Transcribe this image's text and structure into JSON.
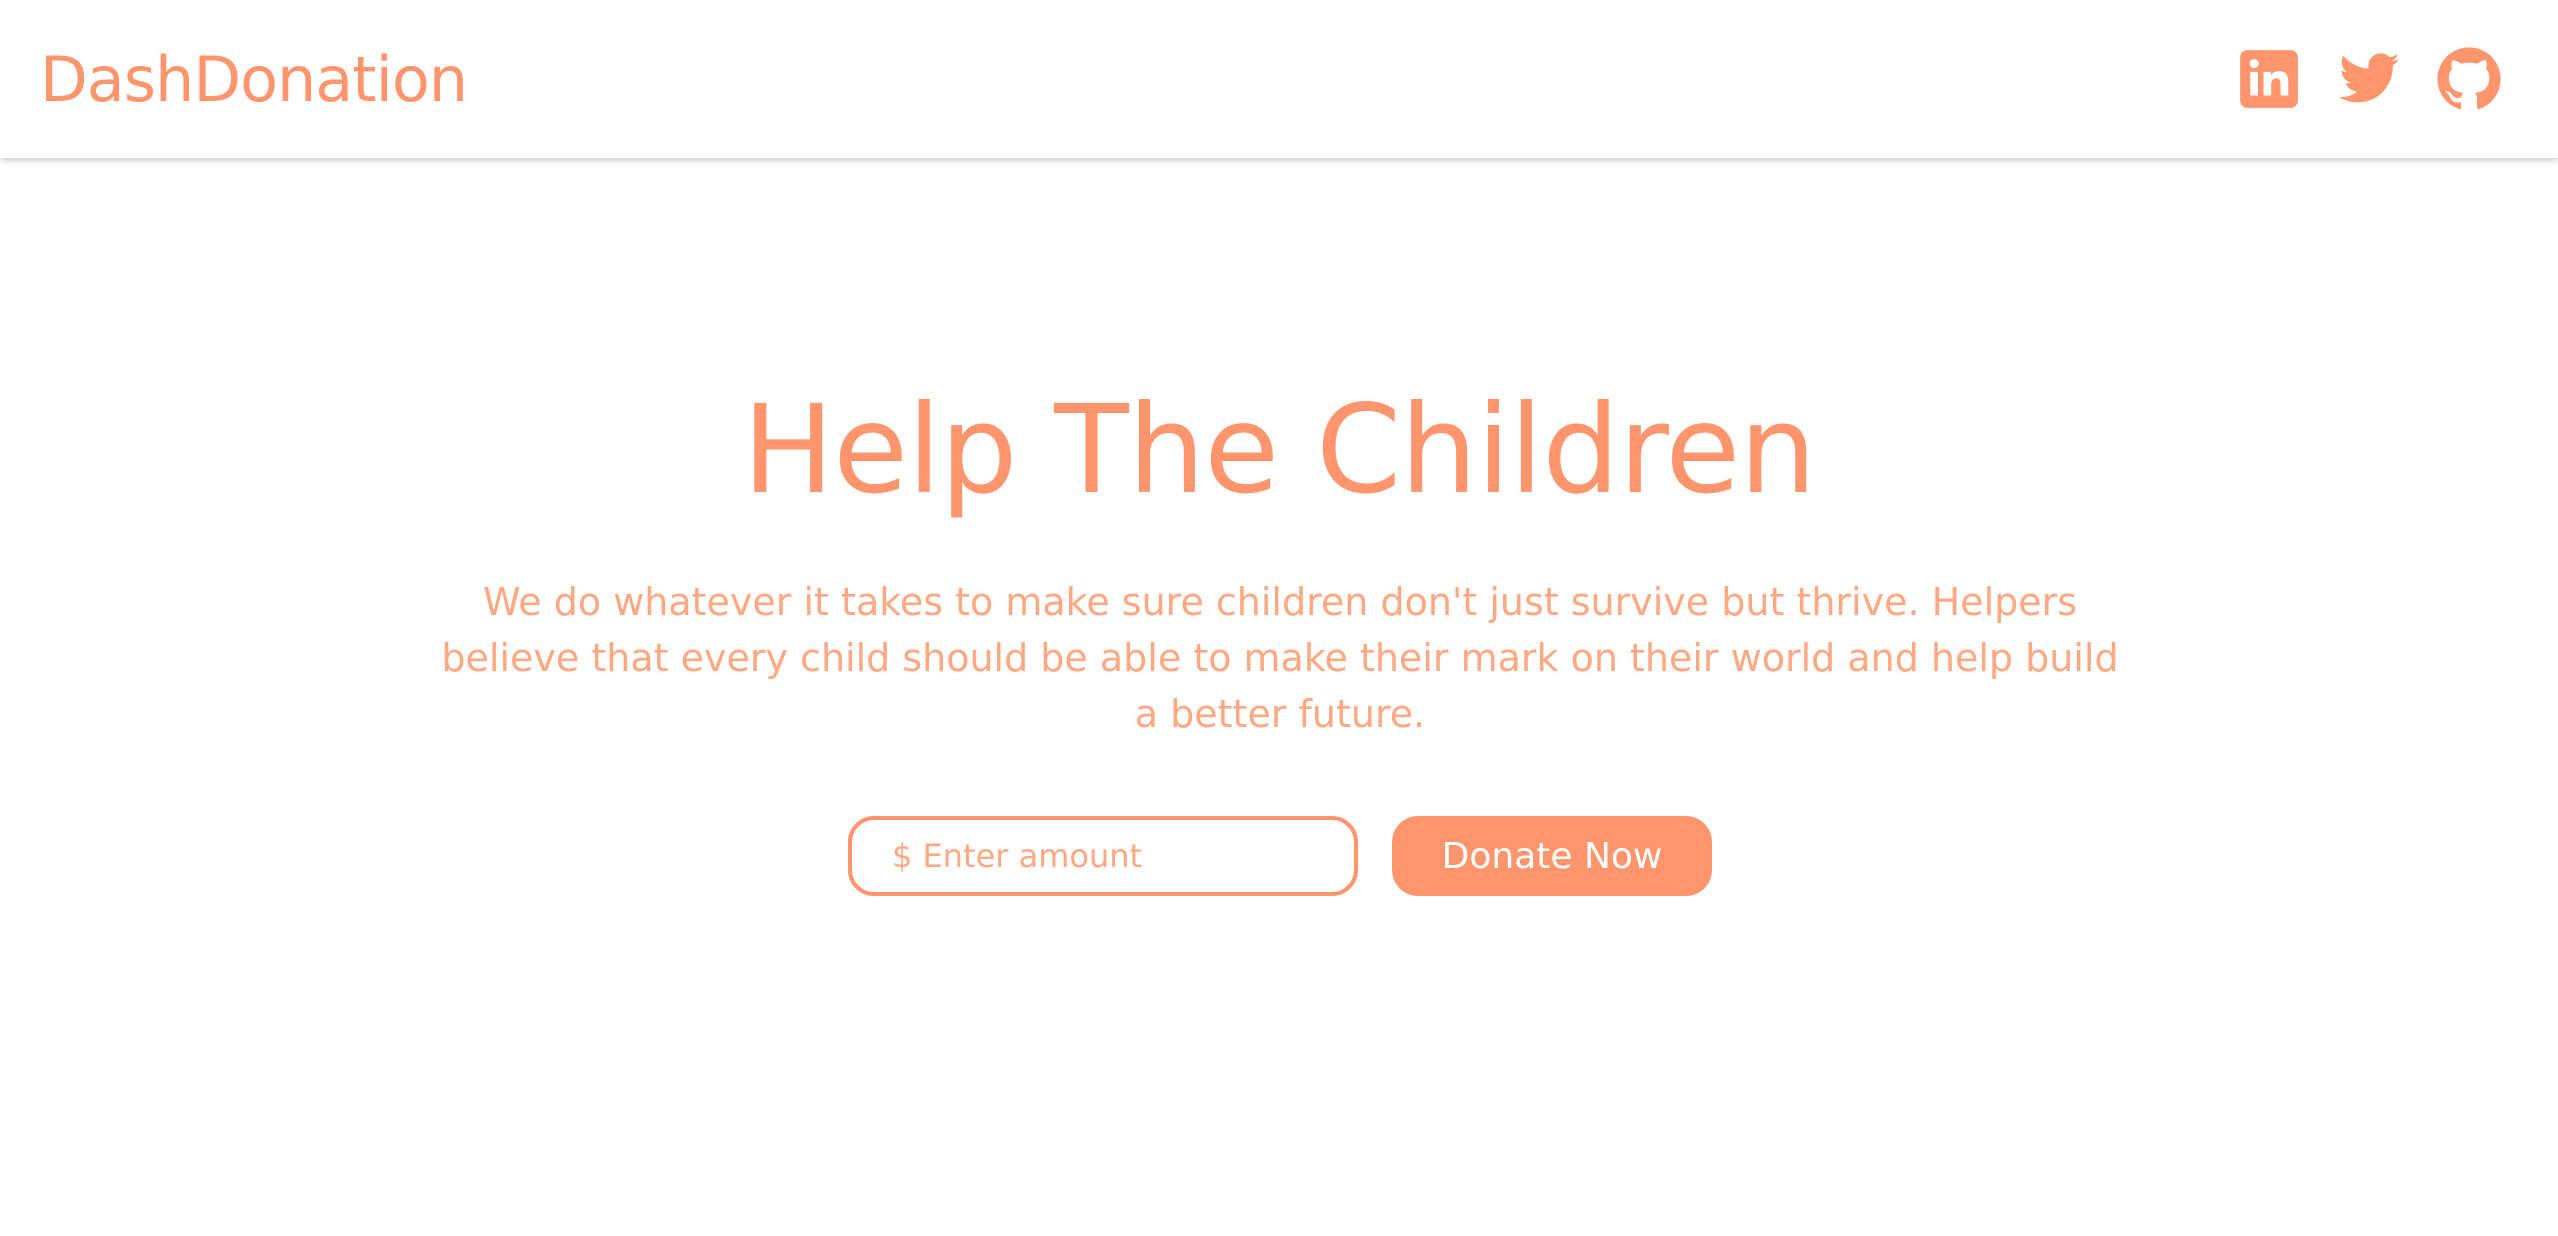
{
  "header": {
    "brand": "DashDonation",
    "social_links": [
      {
        "name": "linkedin",
        "icon": "linkedin-icon"
      },
      {
        "name": "twitter",
        "icon": "twitter-icon"
      },
      {
        "name": "github",
        "icon": "github-icon"
      }
    ]
  },
  "hero": {
    "title": "Help The Children",
    "description": "We do whatever it takes to make sure children don't just survive but thrive. Helpers believe that every child should be able to make their mark on their world and help build a better future."
  },
  "donation_form": {
    "amount_placeholder": "$ Enter amount",
    "amount_value": "",
    "submit_label": "Donate Now"
  },
  "colors": {
    "accent": "#ff956d",
    "accent_light": "#ffa882",
    "background": "#ffffff",
    "button_text": "#ffffff"
  }
}
